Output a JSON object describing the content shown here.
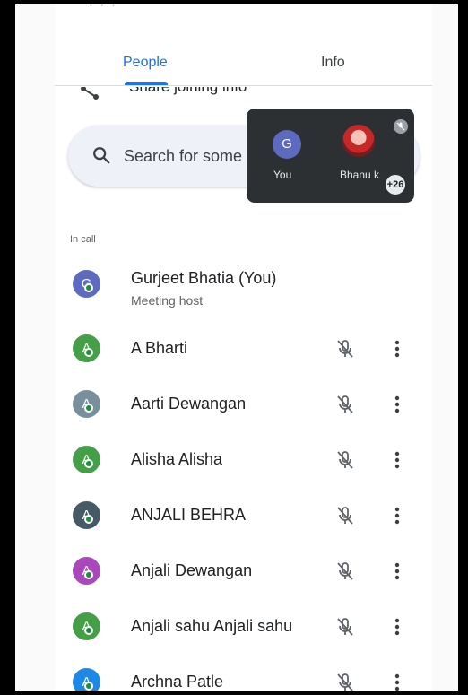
{
  "tabs": [
    {
      "label": "People",
      "selected": true
    },
    {
      "label": "Info",
      "selected": false
    }
  ],
  "share": {
    "label": "Share joining info",
    "icon": "share-icon"
  },
  "search": {
    "placeholder": "Search for some"
  },
  "tile_strip": {
    "you": {
      "initial": "G",
      "label": "You"
    },
    "other": {
      "label": "Bhanu k"
    },
    "more_count": "+26"
  },
  "section_label": "In call",
  "host": {
    "name": "Gurjeet Bhatia (You)",
    "role": "Meeting host",
    "initial": "G",
    "color": "#5c6bc0"
  },
  "participants": [
    {
      "initial": "A",
      "name": "A Bharti",
      "color": "#43a047"
    },
    {
      "initial": "A",
      "name": "Aarti Dewangan",
      "color": "#78909c"
    },
    {
      "initial": "A",
      "name": "Alisha Alisha",
      "color": "#43a047"
    },
    {
      "initial": "A",
      "name": "ANJALI BEHRA",
      "color": "#455a64"
    },
    {
      "initial": "A",
      "name": "Anjali Dewangan",
      "color": "#ab47bc"
    },
    {
      "initial": "A",
      "name": "Anjali sahu Anjali sahu",
      "color": "#43a047"
    },
    {
      "initial": "A",
      "name": "Archna Patle",
      "color": "#1e88e5"
    }
  ],
  "colors": {
    "accent": "#1a73e8",
    "online": "#1e8e3e",
    "tile_bg": "#2d3032"
  }
}
